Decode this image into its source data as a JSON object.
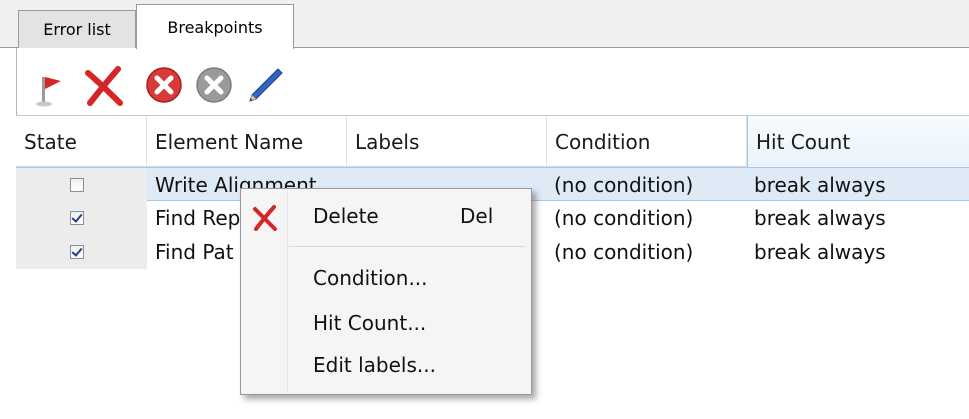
{
  "tabs": {
    "error_list": "Error list",
    "breakpoints": "Breakpoints"
  },
  "toolbar": {
    "buttons": [
      "flag-icon",
      "delete-x-icon",
      "delete-all-icon",
      "disable-all-icon",
      "edit-pencil-icon"
    ],
    "colors": {
      "red": "#d42626",
      "gray": "#8f8f8f",
      "blue": "#2f66c4"
    }
  },
  "table": {
    "headers": {
      "state": "State",
      "name": "Element Name",
      "labels": "Labels",
      "condition": "Condition",
      "hits": "Hit Count"
    },
    "rows": [
      {
        "checked": false,
        "name": "Write Alignment",
        "condition": "(no condition)",
        "hits": "break always",
        "selected": true
      },
      {
        "checked": true,
        "name": "Find Rep",
        "condition": "(no condition)",
        "hits": "break always",
        "selected": false
      },
      {
        "checked": true,
        "name": "Find Pat",
        "condition": "(no condition)",
        "hits": "break always",
        "selected": false
      }
    ]
  },
  "context_menu": {
    "delete": "Delete",
    "delete_key": "Del",
    "condition": "Condition...",
    "hit_count": "Hit Count...",
    "edit_labels": "Edit labels..."
  }
}
